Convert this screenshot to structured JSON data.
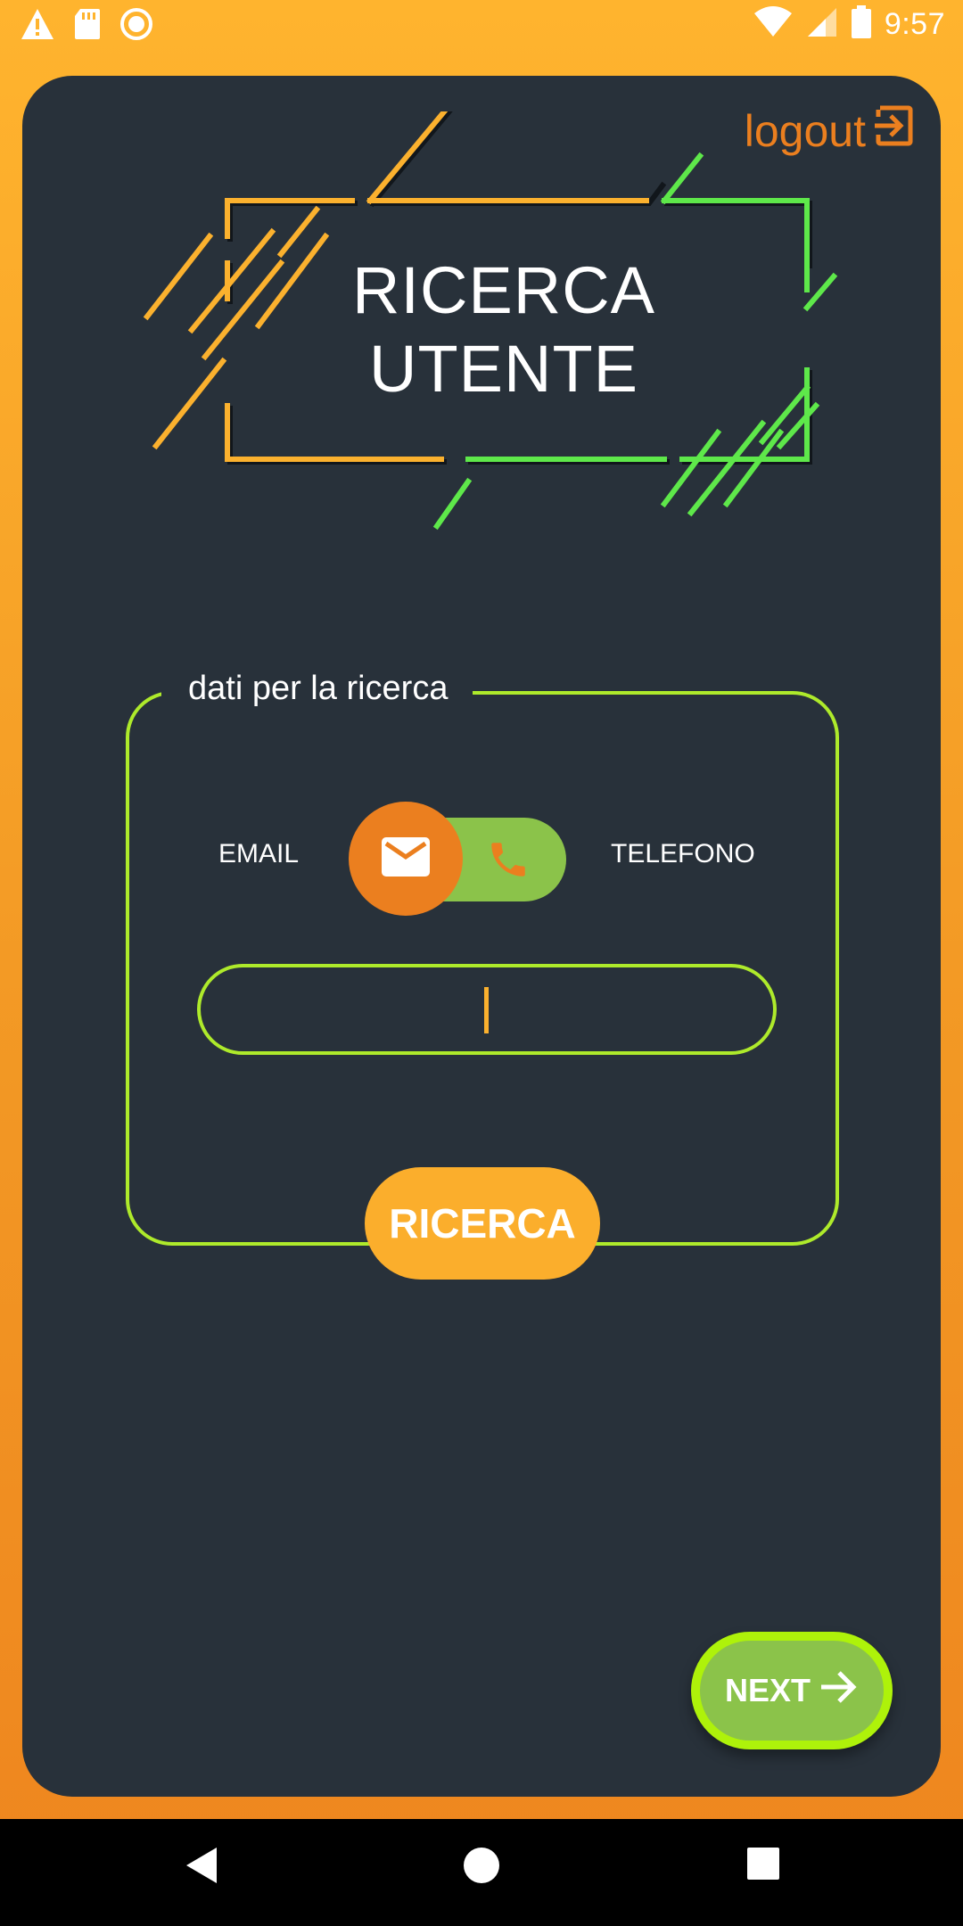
{
  "status_bar": {
    "time": "9:57",
    "left_icons": [
      "warning-icon",
      "sd-card-icon",
      "record-icon"
    ],
    "right_icons": [
      "wifi-icon",
      "signal-icon",
      "battery-icon"
    ]
  },
  "header": {
    "logout_label": "logout",
    "logout_icon": "logout-icon"
  },
  "title": {
    "line1": "RICERCA",
    "line2": "UTENTE"
  },
  "search": {
    "legend": "dati per la ricerca",
    "option_left": "EMAIL",
    "option_right": "TELEFONO",
    "selected": "EMAIL",
    "input_value": "",
    "button_label": "RICERCA"
  },
  "next_button": {
    "label": "NEXT"
  },
  "colors": {
    "background_top": "#FFB42E",
    "background_bottom": "#EE851E",
    "card": "#28313A",
    "accent_orange": "#EB7F1F",
    "accent_yellow": "#FBAE2C",
    "accent_green": "#8BC34A",
    "accent_lime": "#AEEA2B"
  }
}
